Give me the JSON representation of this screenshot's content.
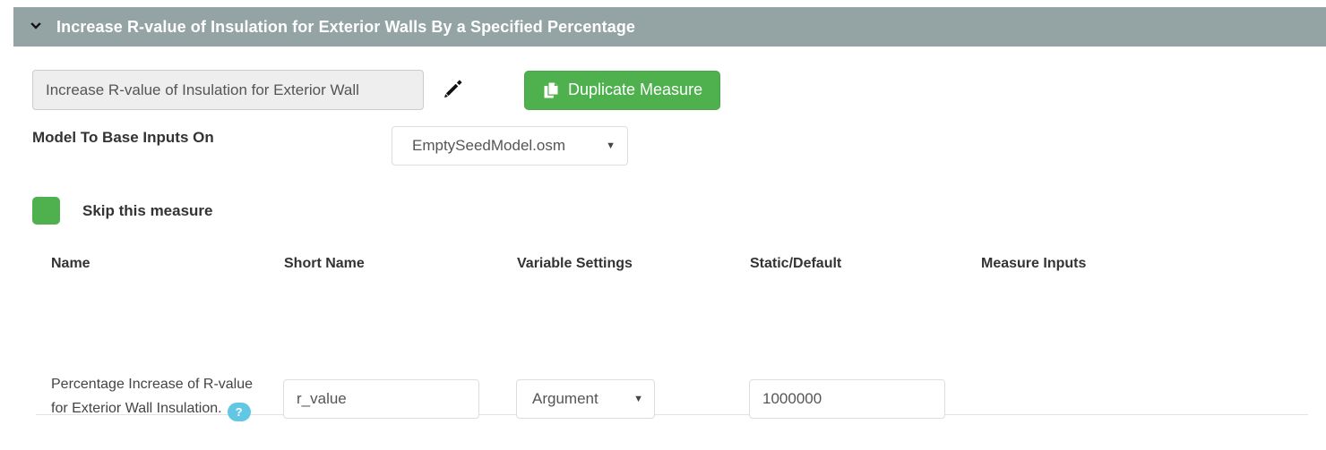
{
  "header": {
    "title": "Increase R-value of Insulation for Exterior Walls By a Specified Percentage",
    "chevron_icon": "chevron-down-icon",
    "background_color": "#94a4a4",
    "text_color": "#ffffff"
  },
  "name_row": {
    "measure_name_value": "Increase R-value of Insulation for Exterior Wall",
    "measure_name_placeholder": "Measure name",
    "edit_icon": "pencil-icon",
    "duplicate_button_label": "Duplicate Measure",
    "duplicate_button_icon": "copy-files-icon",
    "duplicate_button_color": "#4eb14e"
  },
  "seed_model": {
    "label": "Model To Base Inputs On",
    "selected": "EmptySeedModel.osm",
    "caret": "▼"
  },
  "skip_measure": {
    "label": "Skip this measure",
    "checked": true,
    "checkbox_color": "#4eb14e"
  },
  "arguments_table": {
    "columns": [
      "Name",
      "Short Name",
      "Variable Settings",
      "Static/Default",
      "Measure Inputs"
    ],
    "rows": [
      {
        "name": "Percentage Increase of R-value for Exterior Wall Insulation.",
        "help_badge": "?",
        "help_badge_color": "#62c7e3",
        "short_name": "r_value",
        "short_name_placeholder": "Short Name",
        "variable_setting": "Argument",
        "variable_caret": "▼",
        "static_default": "1000000",
        "static_default_placeholder": "Default value",
        "measure_inputs": ""
      }
    ]
  }
}
